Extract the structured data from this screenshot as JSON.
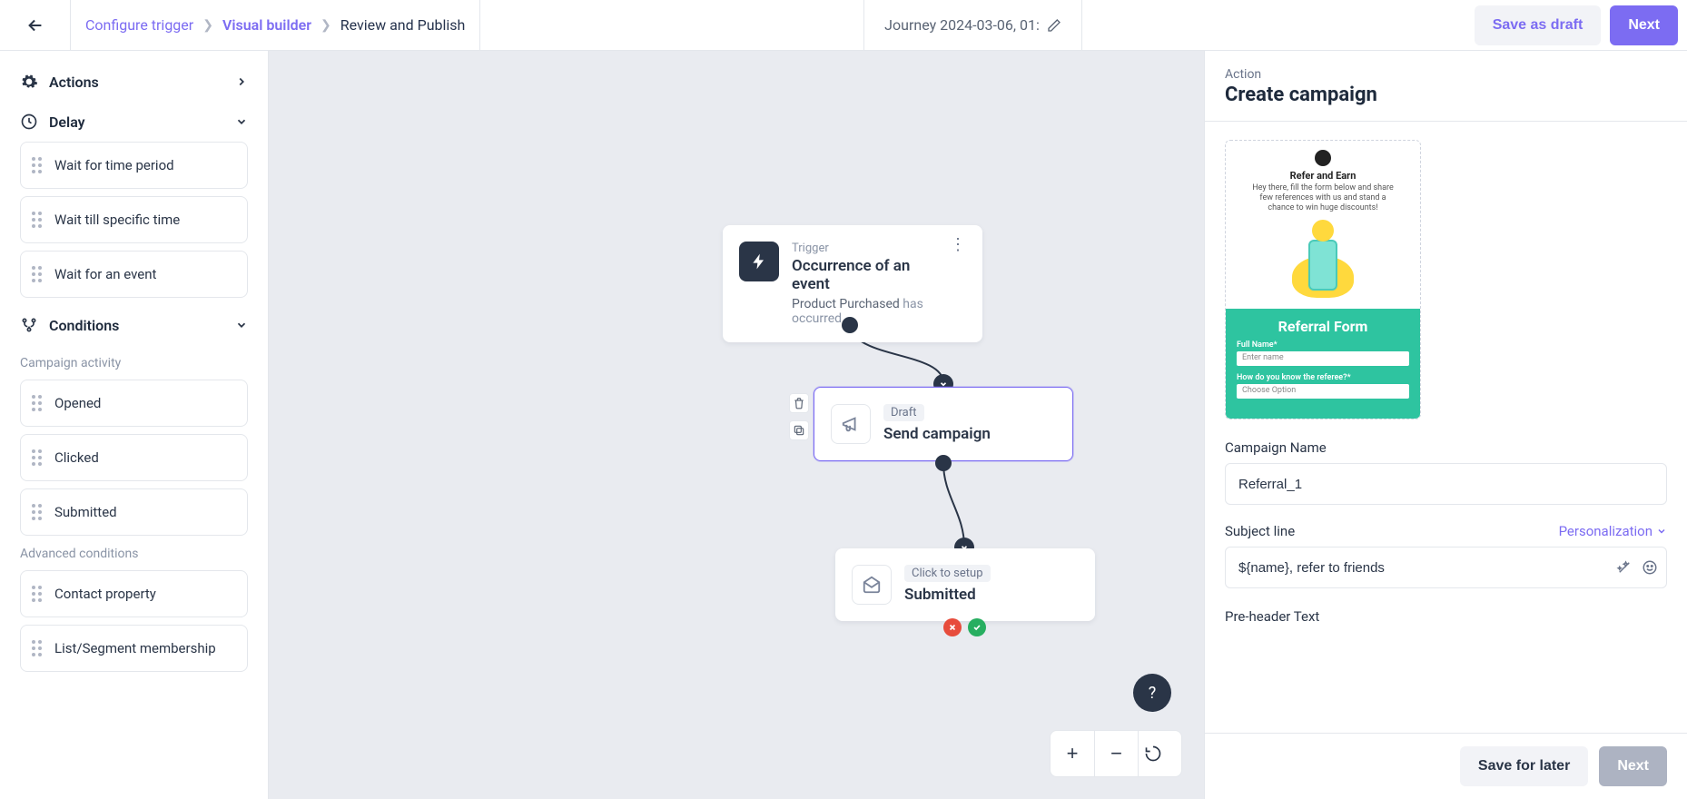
{
  "header": {
    "crumbs": [
      "Configure trigger",
      "Visual builder",
      "Review and Publish"
    ],
    "title": "Journey 2024-03-06, 01:",
    "save_draft": "Save as draft",
    "next": "Next"
  },
  "sidebar": {
    "sections": {
      "actions": "Actions",
      "delay": "Delay",
      "conditions": "Conditions"
    },
    "delay_items": [
      "Wait for time period",
      "Wait till specific time",
      "Wait for an event"
    ],
    "campaign_activity_label": "Campaign activity",
    "campaign_items": [
      "Opened",
      "Clicked",
      "Submitted"
    ],
    "advanced_label": "Advanced conditions",
    "advanced_items": [
      "Contact property",
      "List/Segment membership"
    ]
  },
  "canvas": {
    "trigger": {
      "label": "Trigger",
      "title": "Occurrence of an event",
      "detail_event": "Product Purchased",
      "detail_suffix": "has occurred"
    },
    "send": {
      "badge": "Draft",
      "title": "Send campaign"
    },
    "condition": {
      "badge": "Click to setup",
      "title": "Submitted"
    }
  },
  "panel": {
    "subhead": "Action",
    "title": "Create campaign",
    "preview": {
      "heading": "Refer and Earn",
      "body": "Hey there, fill the form below and share few references with us and stand a chance to win huge discounts!",
      "form_title": "Referral Form",
      "label1": "Full Name*",
      "placeholder1": "Enter name",
      "label2": "How do you know the referee?*",
      "select_text": "Choose Option"
    },
    "campaign_name_label": "Campaign Name",
    "campaign_name_value": "Referral_1",
    "subject_label": "Subject line",
    "personalization": "Personalization",
    "subject_value": "${name}, refer to friends",
    "preheader_label": "Pre-header Text",
    "foot": {
      "save_later": "Save for later",
      "next": "Next"
    }
  }
}
